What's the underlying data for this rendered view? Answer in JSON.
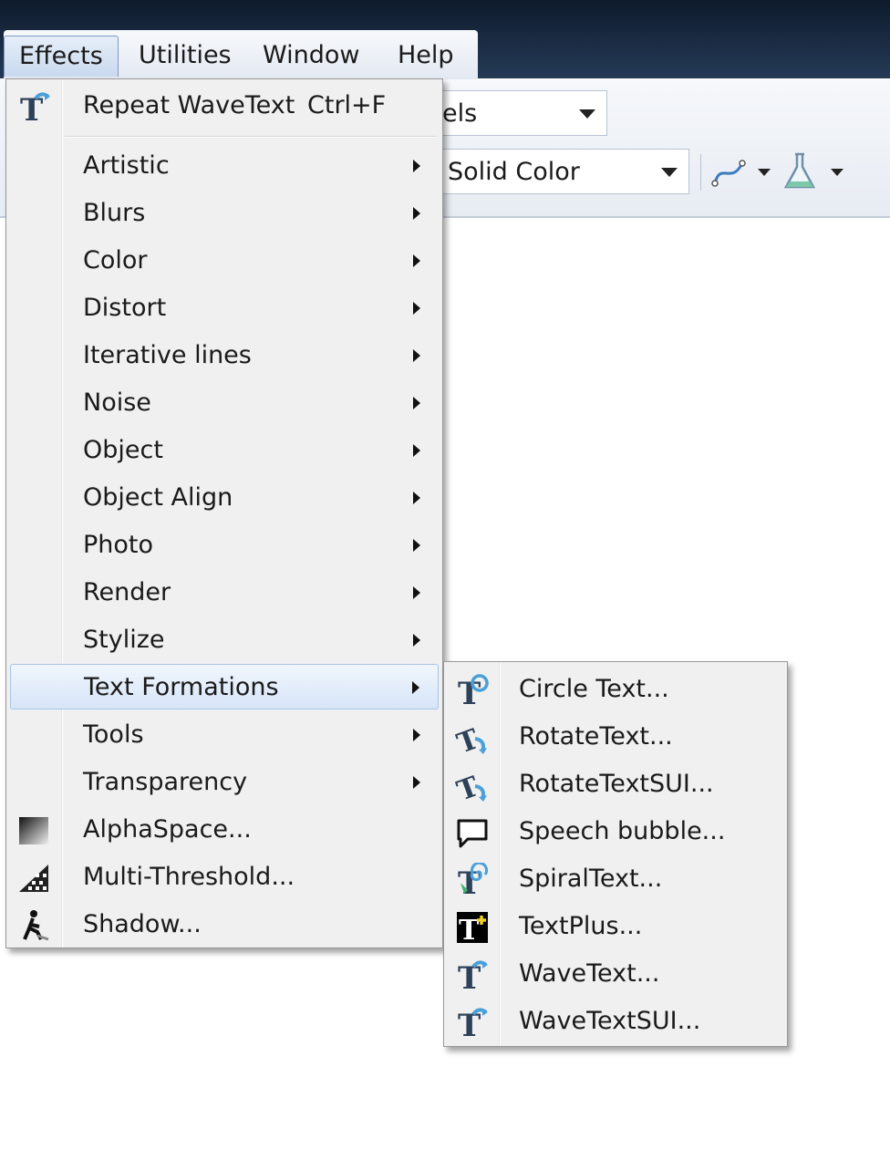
{
  "menubar": {
    "items": [
      {
        "label": "Effects"
      },
      {
        "label": "Utilities"
      },
      {
        "label": "Window"
      },
      {
        "label": "Help"
      }
    ]
  },
  "toolbar": {
    "units_combo_visible_text": "els",
    "fill_combo_value": "Solid Color",
    "icons": [
      "curve-tool-icon",
      "flask-icon"
    ]
  },
  "effects_menu": {
    "repeat": {
      "label": "Repeat WaveText",
      "shortcut": "Ctrl+F",
      "icon": "wavetext-icon"
    },
    "submenus": [
      "Artistic",
      "Blurs",
      "Color",
      "Distort",
      "Iterative lines",
      "Noise",
      "Object",
      "Object Align",
      "Photo",
      "Render",
      "Stylize",
      "Text Formations",
      "Tools",
      "Transparency"
    ],
    "highlighted": "Text Formations",
    "commands": [
      {
        "label": "AlphaSpace...",
        "icon": "alphaspace-icon"
      },
      {
        "label": "Multi-Threshold...",
        "icon": "multi-threshold-icon"
      },
      {
        "label": "Shadow...",
        "icon": "shadow-icon"
      }
    ]
  },
  "text_formations_menu": {
    "items": [
      {
        "label": "Circle Text...",
        "icon": "circle-text-icon"
      },
      {
        "label": "RotateText...",
        "icon": "rotate-text-icon"
      },
      {
        "label": "RotateTextSUI...",
        "icon": "rotate-text-sui-icon"
      },
      {
        "label": "Speech bubble...",
        "icon": "speech-bubble-icon"
      },
      {
        "label": "SpiralText...",
        "icon": "spiral-text-icon"
      },
      {
        "label": "TextPlus...",
        "icon": "textplus-icon"
      },
      {
        "label": "WaveText...",
        "icon": "wavetext-icon"
      },
      {
        "label": "WaveTextSUI...",
        "icon": "wavetext-sui-icon"
      }
    ]
  },
  "colors": {
    "highlight": "#d6e5f7",
    "menu_bg": "#f0f0f0",
    "titlebar": "#1c2e46"
  }
}
